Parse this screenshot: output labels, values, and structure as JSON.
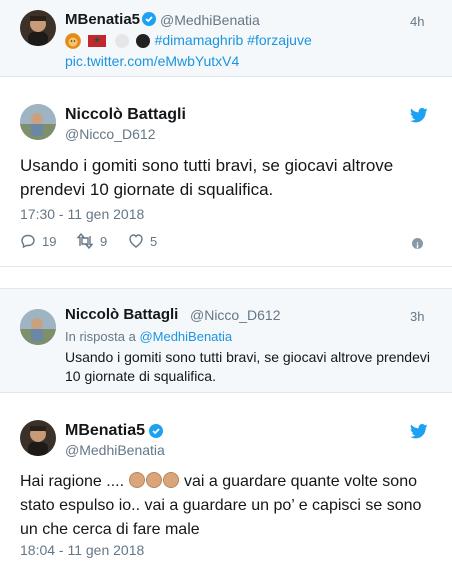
{
  "colors": {
    "accent": "#1da1f2",
    "link": "#1b95e0",
    "muted": "#657786",
    "background_alt": "#f5f8fa"
  },
  "tweet1": {
    "display_name": "MBenatia5",
    "handle": "@MedhiBenatia",
    "time": "4h",
    "hashtags": "#dimamaghrib #forzajuve",
    "link": "pic.twitter.com/eMwbYutxV4",
    "icons": [
      "lion-emoji",
      "morocco-flag",
      "white-circle",
      "black-circle"
    ]
  },
  "tweet2": {
    "display_name": "Niccolò Battagli",
    "handle": "@Nicco_D612",
    "text": "Usando i gomiti sono tutti bravi, se giocavi altrove prendevi 10 giornate di squalifica.",
    "timestamp": "17:30 - 11 gen 2018",
    "replies": "19",
    "retweets": "9",
    "likes": "5"
  },
  "tweet3": {
    "display_name": "Niccolò Battagli",
    "handle": "@Nicco_D612",
    "time": "3h",
    "reply_prefix": "In risposta a ",
    "reply_to": "@MedhiBenatia",
    "text_line1": "Usando i gomiti sono tutti bravi, se giocavi altrove prendevi",
    "text_line2": "10 giornate di squalifica."
  },
  "tweet4": {
    "display_name": "MBenatia5",
    "handle": "@MedhiBenatia",
    "text_part1": "Hai ragione .... ",
    "text_part2": " vai a guardare quante volte sono",
    "text_line2": "stato espulso io.. vai a guardare un po’ e capisci se sono",
    "text_line3": "un che cerca di fare male",
    "timestamp": "18:04 - 11 gen 2018"
  }
}
